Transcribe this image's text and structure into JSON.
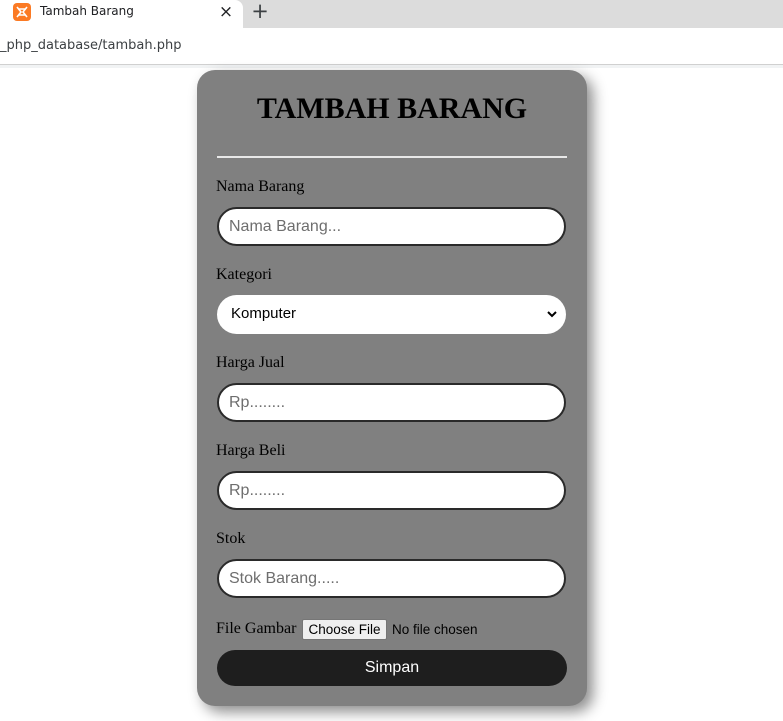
{
  "browser": {
    "tab_title": "Tambah Barang",
    "close_glyph": "×",
    "new_tab_glyph": "+",
    "address": "_php_database/tambah.php",
    "favicon_icon": "xampp-icon",
    "favicon_color": "#fb7a24"
  },
  "form": {
    "title": "TAMBAH BARANG",
    "card_color": "#808080",
    "fields": {
      "nama": {
        "label": "Nama Barang",
        "value": "",
        "placeholder": "Nama Barang..."
      },
      "kategori": {
        "label": "Kategori",
        "selected": "Komputer"
      },
      "harga_jual": {
        "label": "Harga Jual",
        "value": "",
        "placeholder": "Rp........"
      },
      "harga_beli": {
        "label": "Harga Beli",
        "value": "",
        "placeholder": "Rp........"
      },
      "stok": {
        "label": "Stok",
        "value": "",
        "placeholder": "Stok Barang....."
      }
    },
    "file": {
      "label": "File Gambar",
      "button": "Choose File",
      "status": "No file chosen"
    },
    "submit": {
      "label": "Simpan",
      "color": "#1e1e1e"
    }
  }
}
